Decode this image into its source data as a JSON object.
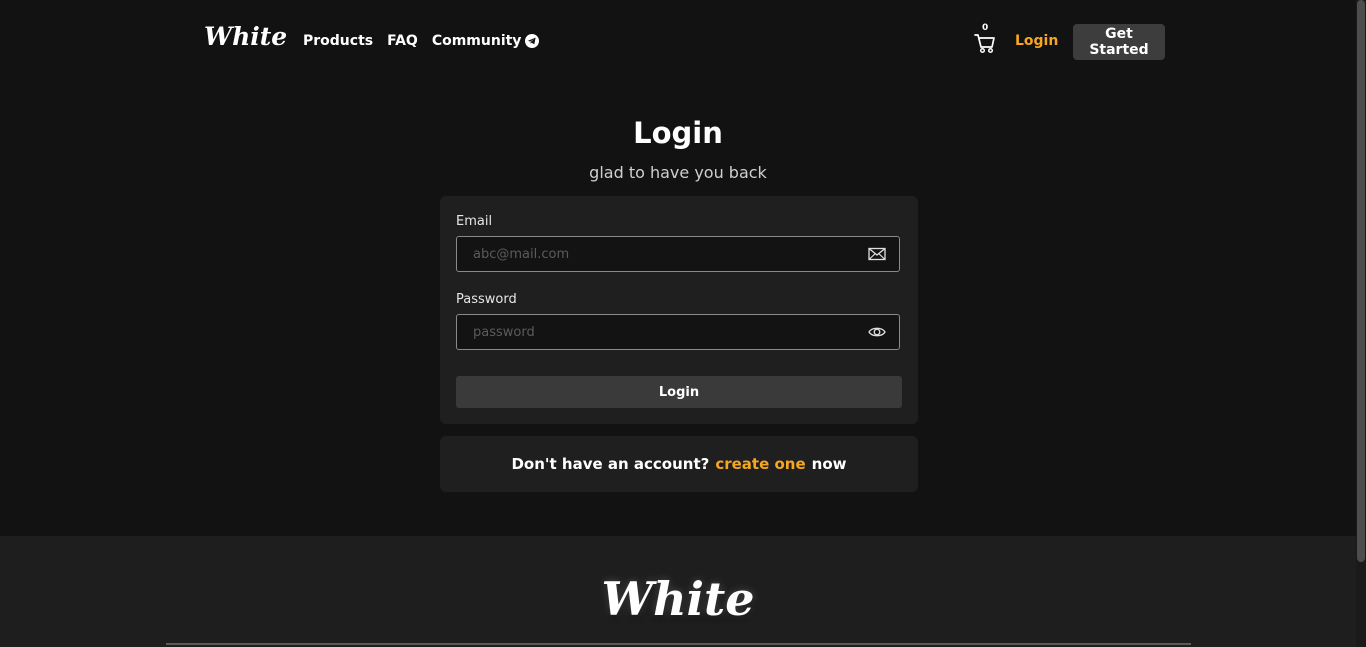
{
  "header": {
    "logo": "White",
    "nav": [
      {
        "label": "Products"
      },
      {
        "label": "FAQ"
      },
      {
        "label": "Community"
      }
    ],
    "cart_count": "0",
    "login_label": "Login",
    "get_started_label": "Get Started",
    "icons": {
      "cart": "cart-icon",
      "community": "telegram-icon"
    }
  },
  "main": {
    "title": "Login",
    "subtitle": "glad to have you back",
    "email": {
      "label": "Email",
      "placeholder": "abc@mail.com",
      "value": "",
      "icon": "envelope-icon"
    },
    "password": {
      "label": "Password",
      "placeholder": "password",
      "value": "",
      "icon": "eye-icon"
    },
    "submit_label": "Login",
    "signup": {
      "prefix": "Don't have an account?",
      "link": "create one",
      "suffix": "now"
    }
  },
  "footer": {
    "logo": "White"
  },
  "colors": {
    "background": "#121212",
    "card": "#1f1f1f",
    "accent": "#f5a623",
    "button": "#3d3d3d",
    "footer": "#1e1e1e"
  }
}
